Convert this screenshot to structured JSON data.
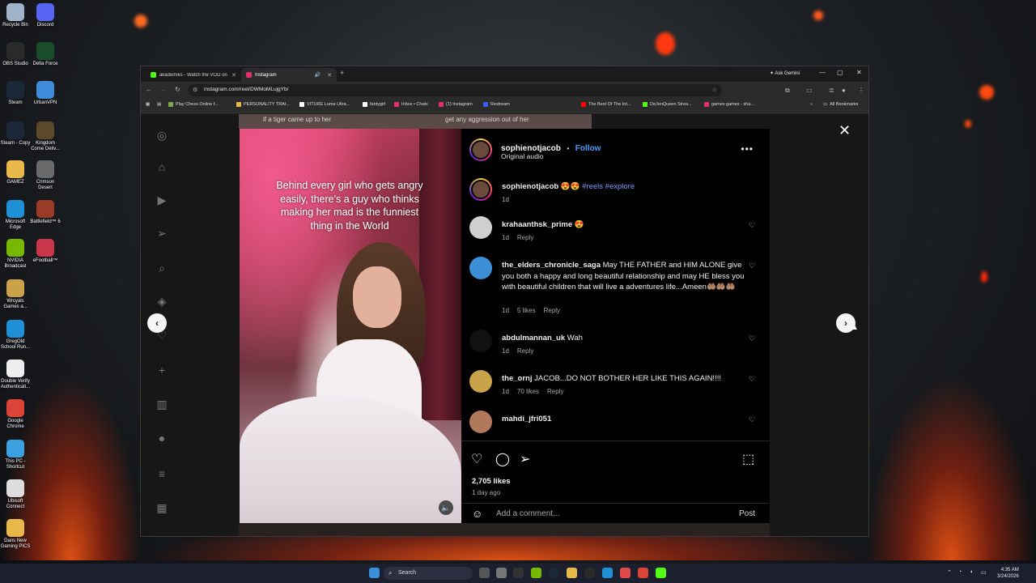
{
  "desktop": {
    "icons": [
      {
        "label": "Recycle Bin",
        "color": "#9fb4c8"
      },
      {
        "label": "Discord",
        "color": "#5865f2"
      },
      {
        "label": "OBS Studio",
        "color": "#2a2a2a"
      },
      {
        "label": "Delta Force",
        "color": "#1b4d2a"
      },
      {
        "label": "Steam",
        "color": "#1b2838"
      },
      {
        "label": "UrbanVPN",
        "color": "#3d8bd9"
      },
      {
        "label": "Steam - Copy",
        "color": "#1b2838"
      },
      {
        "label": "Kingdom Come Deliv...",
        "color": "#5c4a2a"
      },
      {
        "label": "GAMEZ",
        "color": "#e8b84a"
      },
      {
        "label": "Crimson Desert",
        "color": "#6a6a6a"
      },
      {
        "label": "Microsoft Edge",
        "color": "#1f8fd6"
      },
      {
        "label": "Battlefield™ 6",
        "color": "#9a3b2a"
      },
      {
        "label": "NVIDIA Broadcast",
        "color": "#76b900"
      },
      {
        "label": "eFootball™",
        "color": "#c9364a"
      },
      {
        "label": "Wrcyals Games a...",
        "color": "#c9a24a"
      },
      {
        "label": "GregOld School Run...",
        "color": "#1f8fd6"
      },
      {
        "label": "Double Verify Authenticati...",
        "color": "#eeeeee"
      },
      {
        "label": "Google Chrome",
        "color": "#db4437"
      },
      {
        "label": "This PC - Shortcut",
        "color": "#3aa0e0"
      },
      {
        "label": "Ubisoft Connect",
        "color": "#dddddd"
      },
      {
        "label": "Dans New Gaming PICS",
        "color": "#e8b84a"
      }
    ]
  },
  "browser": {
    "tabs": [
      {
        "title": "akademiks - Watch the VOD on",
        "favicon_color": "#53fc18"
      },
      {
        "title": "Instagram",
        "favicon_color": "#e1306c"
      }
    ],
    "ask_gemini": "Ask Gemini",
    "url": "instagram.com/reel/DWMoMLujgYb/",
    "bookmarks": [
      {
        "label": "Play Chess Online f...",
        "color": "#7fa650"
      },
      {
        "label": "PERSONALITY TRAI...",
        "color": "#e8b84a"
      },
      {
        "label": "VITURE Luma Ultra...",
        "color": "#ffffff"
      },
      {
        "label": "fantygirl",
        "color": "#ffffff"
      },
      {
        "label": "Inbox • Chats",
        "color": "#e1306c"
      },
      {
        "label": "(1) Instagram",
        "color": "#e1306c"
      },
      {
        "label": "Restream",
        "color": "#3a5cf5"
      },
      {
        "label": "The Best Of The Int...",
        "color": "#ff0000"
      },
      {
        "label": "DeJenQueen Strea...",
        "color": "#53fc18"
      },
      {
        "label": "games games - sha...",
        "color": "#e1306c"
      }
    ],
    "all_bookmarks": "All Bookmarks"
  },
  "reel": {
    "bg_top_left": "if a tiger came up to her",
    "bg_top_right": "get any aggression out of her",
    "caption": "Behind every girl who gets angry easily, there's a guy who thinks making her mad is the funniest thing in the World",
    "mute_icon": "speaker-icon"
  },
  "panel": {
    "author": "sophienotjacob",
    "separator": "•",
    "follow": "Follow",
    "audio": "Original audio",
    "more": "•••",
    "post_caption": {
      "user": "sophienotjacob",
      "emojis": "😍😍",
      "tags": "#reels #explore",
      "time": "1d"
    },
    "comments": [
      {
        "user": "krahaanthsk_prime",
        "text": "😍",
        "time": "1d",
        "likes": "",
        "reply": "Reply",
        "avatar": "#cfcfcf"
      },
      {
        "user": "the_elders_chronicle_saga",
        "text": "May THE FATHER and HIM ALONE give you both a happy and long beautiful relationship and may HE bless you with beautiful children that will live a adventures life...Ameen🤲🏽🤲🏽🤲🏽",
        "time": "1d",
        "likes": "5 likes",
        "reply": "Reply",
        "avatar": "#3a8fd6"
      },
      {
        "user": "abdulmannan_uk",
        "text": "Wah",
        "time": "1d",
        "likes": "",
        "reply": "Reply",
        "avatar": "#111111"
      },
      {
        "user": "the_ornj",
        "text": "JACOB...DO NOT BOTHER HER LIKE THIS AGAIN!!!!",
        "time": "1d",
        "likes": "70 likes",
        "reply": "Reply",
        "avatar": "#c9a24a"
      },
      {
        "user": "mahdi_jfri051",
        "text": "",
        "time": "",
        "likes": "",
        "reply": "",
        "avatar": "#b07a5a"
      }
    ],
    "likes": "2,705 likes",
    "ago": "1 day ago",
    "add_comment": "Add a comment...",
    "post": "Post"
  },
  "taskbar": {
    "search": "Search",
    "time": "4:35 AM",
    "date": "3/24/2026"
  },
  "colors": {
    "accent_blue": "#4f9ef8",
    "ig_black": "#000000",
    "browser_dark": "#2b2b2b"
  }
}
